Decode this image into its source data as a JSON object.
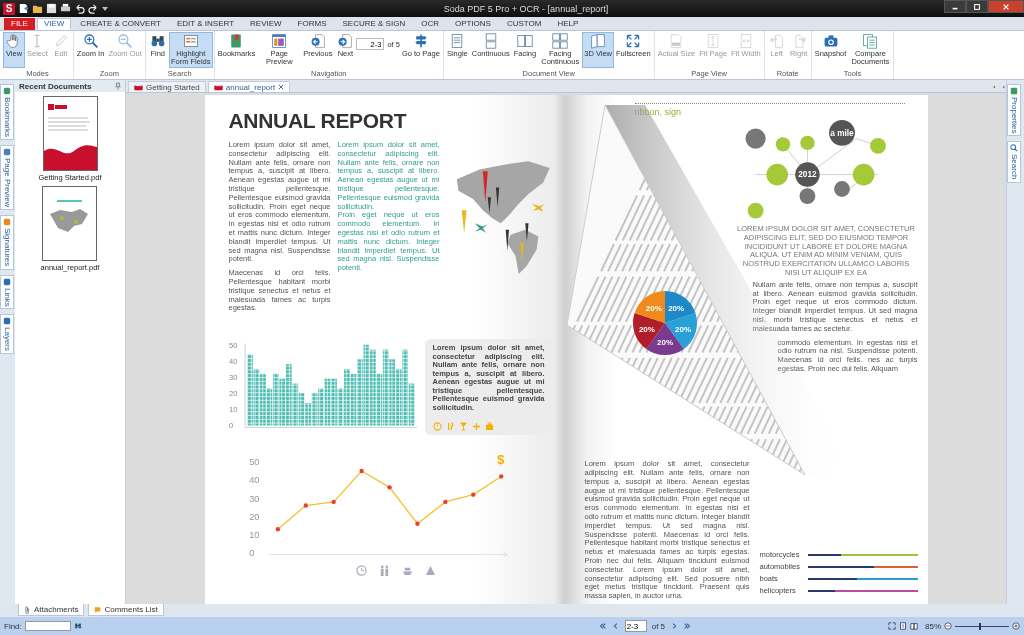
{
  "window": {
    "app_letter": "S",
    "title": "Soda PDF 5 Pro + OCR - [annual_report]"
  },
  "menu_tabs": [
    {
      "label": "FILE",
      "kind": "file",
      "selected": false
    },
    {
      "label": "VIEW",
      "kind": "tab",
      "selected": true
    },
    {
      "label": "CREATE & CONVERT",
      "kind": "tab",
      "selected": false
    },
    {
      "label": "EDIT & INSERT",
      "kind": "tab",
      "selected": false
    },
    {
      "label": "REVIEW",
      "kind": "tab",
      "selected": false
    },
    {
      "label": "FORMS",
      "kind": "tab",
      "selected": false
    },
    {
      "label": "SECURE & SIGN",
      "kind": "tab",
      "selected": false
    },
    {
      "label": "OCR",
      "kind": "tab",
      "selected": false
    },
    {
      "label": "OPTIONS",
      "kind": "tab",
      "selected": false
    },
    {
      "label": "CUSTOM",
      "kind": "tab",
      "selected": false
    },
    {
      "label": "HELP",
      "kind": "tab",
      "selected": false
    }
  ],
  "ribbon_groups": [
    {
      "label": "Modes",
      "items": [
        {
          "kind": "button",
          "label": "View",
          "selected": true,
          "disabled": false
        },
        {
          "kind": "button",
          "label": "Select",
          "selected": false,
          "disabled": true
        },
        {
          "kind": "button",
          "label": "Edit",
          "selected": false,
          "disabled": true
        }
      ]
    },
    {
      "label": "Zoom",
      "items": [
        {
          "kind": "button",
          "label": "Zoom In",
          "selected": false,
          "disabled": false
        },
        {
          "kind": "button",
          "label": "Zoom Out",
          "selected": false,
          "disabled": true
        }
      ]
    },
    {
      "label": "Search",
      "items": [
        {
          "kind": "button",
          "label": "Find",
          "selected": false,
          "disabled": false
        },
        {
          "kind": "button",
          "label": "Highlight Form Fields",
          "selected": true,
          "disabled": false
        }
      ]
    },
    {
      "label": "Navigation",
      "items": [
        {
          "kind": "button",
          "label": "Bookmarks",
          "selected": false,
          "disabled": false
        },
        {
          "kind": "button",
          "label": "Page Preview",
          "selected": false,
          "disabled": false
        },
        {
          "kind": "button",
          "label": "Previous",
          "selected": false,
          "disabled": false
        },
        {
          "kind": "button",
          "label": "Next",
          "selected": false,
          "disabled": false
        },
        {
          "kind": "page-field",
          "value": "2-3",
          "of": "of 5"
        },
        {
          "kind": "button",
          "label": "Go to Page",
          "selected": false,
          "disabled": false
        }
      ]
    },
    {
      "label": "Document View",
      "items": [
        {
          "kind": "button",
          "label": "Single",
          "selected": false,
          "disabled": false
        },
        {
          "kind": "button",
          "label": "Continuous",
          "selected": false,
          "disabled": false
        },
        {
          "kind": "button",
          "label": "Facing",
          "selected": false,
          "disabled": false
        },
        {
          "kind": "button",
          "label": "Facing Continuous",
          "selected": false,
          "disabled": false
        },
        {
          "kind": "button",
          "label": "3D View",
          "selected": true,
          "disabled": false
        },
        {
          "kind": "button",
          "label": "Fullscreen",
          "selected": false,
          "disabled": false
        }
      ]
    },
    {
      "label": "Page View",
      "items": [
        {
          "kind": "button",
          "label": "Actual Size",
          "selected": false,
          "disabled": true
        },
        {
          "kind": "button",
          "label": "Fit Page",
          "selected": false,
          "disabled": true
        },
        {
          "kind": "button",
          "label": "Fit Width",
          "selected": false,
          "disabled": true
        }
      ]
    },
    {
      "label": "Rotate",
      "items": [
        {
          "kind": "button",
          "label": "Left",
          "selected": false,
          "disabled": true
        },
        {
          "kind": "button",
          "label": "Right",
          "selected": false,
          "disabled": true
        }
      ]
    },
    {
      "label": "Tools",
      "items": [
        {
          "kind": "button",
          "label": "Snapshot",
          "selected": false,
          "disabled": false
        },
        {
          "kind": "button",
          "label": "Compare Documents",
          "selected": false,
          "disabled": false
        }
      ]
    }
  ],
  "left_tabs": [
    {
      "label": "Bookmarks"
    },
    {
      "label": "Page Preview"
    },
    {
      "label": "Signatures"
    },
    {
      "label": "Links"
    },
    {
      "label": "Layers"
    }
  ],
  "panel": {
    "title": "Recent Documents",
    "documents": [
      {
        "name": "Getting Started.pdf"
      },
      {
        "name": "annual_report.pdf"
      }
    ]
  },
  "doc_tabs": [
    {
      "label": "Getting Started",
      "selected": false,
      "closable": false
    },
    {
      "label": "annual_report",
      "selected": true,
      "closable": true
    }
  ],
  "right_tabs": [
    {
      "label": "Properties"
    },
    {
      "label": "Search"
    }
  ],
  "left_page": {
    "title": "ANNUAL REPORT",
    "column_1": [
      "Lorem ipsum dolor sit amet, consectetur adipiscing elit. Nullam ante felis, ornare non tempus a, suscipit at libero. Aenean egestas augue ut mi tristique pellentesque. Pellentesque euismod gravida sollicitudin. Proin eget neque ut eros commodo elementum. In egestas nisi et odio rutrum et mattis nunc dictum. Integer blandit imperdiet tempus. Ut sed magna nisl. Suspendisse potenti.",
      "Maecenas id orci felis. Pellentesque habitant morbi tristique senectus et netus et malesuada fames ac turpis egestas."
    ],
    "column_2": [
      "Lorem ipsum dolor sit amet, consectetur adipiscing elit. Nullam ante felis, ornare non tempus a, suscipit at libero. Aenean egestas augue ut mi tristique pellentesque. Pellentesque euismod gravida sollicitudin.",
      "Proin eget neque ut eros commodo elementum. In egestas nisi et odio rutrum et mattis nunc dictum. Integer blandit imperdiet tempus. Ut sed magna nisl. Suspendisse potenti."
    ],
    "bar_chart": {
      "chart_data": {
        "type": "bar",
        "values": [
          44,
          35,
          32,
          23,
          32,
          29,
          38,
          26,
          20,
          14,
          20,
          23,
          29,
          29,
          23,
          35,
          32,
          41,
          50,
          47,
          32,
          47,
          41,
          35,
          47,
          26
        ],
        "ylim": [
          0,
          50
        ],
        "yticks": [
          0,
          10,
          20,
          30,
          40,
          50
        ]
      }
    },
    "info_box": {
      "text": "Lorem ipsum dolor sit amet, consectetur adipiscing elit. Nullam ante felis, ornare non tempus a, suscipit at libero. Aenean egestas augue ut mi tristique pellentesque. Pellentesque euismod gravida sollicitudin."
    },
    "line_chart": {
      "symbol": "$",
      "chart_data": {
        "type": "line",
        "values": [
          13,
          26,
          28,
          45,
          36,
          16,
          28,
          32,
          42
        ],
        "ylim": [
          0,
          50
        ],
        "yticks": [
          0,
          10,
          20,
          30,
          40,
          50
        ]
      }
    }
  },
  "right_page": {
    "heading": "ribbon, sign",
    "node_labels": [
      "2012",
      "a mile"
    ],
    "caption": "LOREM IPSUM DOLOR SIT AMET, CONSECTETUR ADIPISCING ELIT, SED DO EIUSMOD TEMPOR INCIDIDUNT UT LABORE ET DOLORE MAGNA ALIQUA. UT ENIM AD MINIM VENIAM, QUIS NOSTRUD EXERCITATION ULLAMCO LABORIS NISI UT ALIQUIP EX EA",
    "fragments": [
      "Nullam ante felis, ornare non tempus a, suscipit at libero. Aenean euismod gravida sollicitudin. Proin eget neque ut eros commodo dictum. Integer blandit imperdiet tempus. Ut sed magna nisl. morbi tristique senectus et netus et malesuada fames ac sectetur.",
      "commodo elementum. In egestas nisi et odio rutrum na nisl. Suspendisse potenti. Maecenas id orci felis. nes ac turpis egestas. Proin nec dui felis. Aliquam"
    ],
    "paragraph": "Lorem ipsum dolor sit amet, consectetur adipiscing elit. Nullam ante felis, ornare non tempus a, suscipit at libero. Aenean egestas augue ut mi tristique pellentesque. Pellentesque euismod gravida sollicitudin. Proin eget neque ut eros commodo elementum. In egestas nisi et odio rutrum et mattis nunc dictum. Integer blandit imperdiet tempus. Ut sed magna nisl. Suspendisse potenti. Maecenas id orci felis. Pellentesque habitant morbi tristique senectus et netus et malesuada fames ac turpis egestas. Proin nec dui felis. Aliquam tincidunt euismod consectetur. Lorem ipsum dolor sit amet, consectetur adipiscing elit. Sed posuere nibh eget metus tristique tincidunt. Praesent quis massa sapien, in auctor urna.",
    "legend": [
      {
        "label": "motorcycles",
        "color": "#9dc43a",
        "level": 0.3
      },
      {
        "label": "automobiles",
        "color": "#e0602c",
        "level": 0.6
      },
      {
        "label": "boats",
        "color": "#2a9fd6",
        "level": 0.45
      },
      {
        "label": "helicopters",
        "color": "#c04a9a",
        "level": 0.25
      }
    ],
    "pie": {
      "chart_data": {
        "type": "pie",
        "values": [
          20,
          20,
          20,
          20,
          20
        ],
        "value_labels": [
          "20%",
          "20%",
          "20%",
          "20%",
          "20%"
        ]
      }
    }
  },
  "bottom_tabs": [
    {
      "label": "Attachments"
    },
    {
      "label": "Comments List"
    }
  ],
  "status_bar": {
    "find_label": "Find:",
    "page": "2-3",
    "of": "of 5",
    "zoom": "85%",
    "zoom_slider": {
      "level": 0.45
    }
  }
}
